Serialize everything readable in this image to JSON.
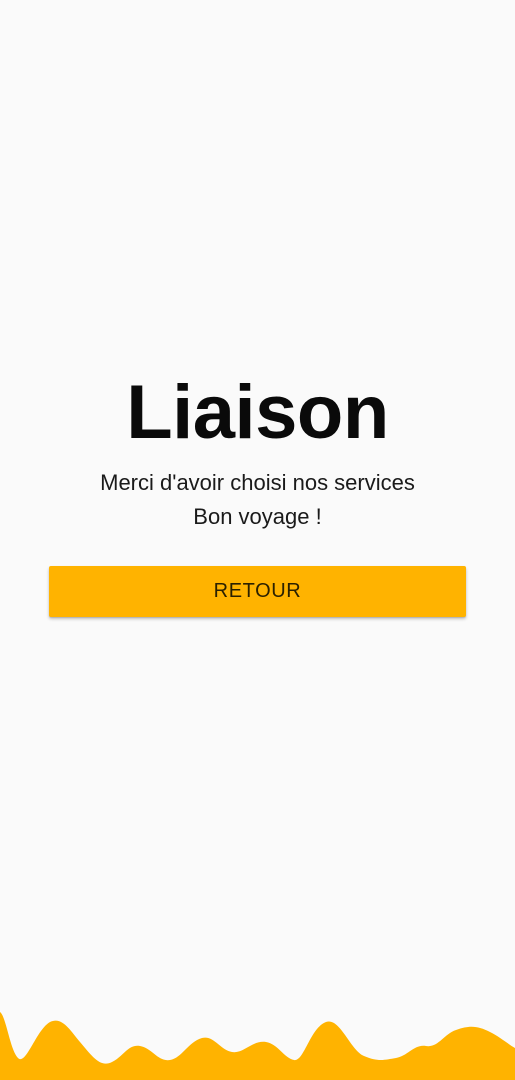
{
  "screen": {
    "title": "Liaison",
    "message_line_1": "Merci d'avoir choisi nos services",
    "message_line_2": "Bon voyage !",
    "retour_label": "RETOUR"
  },
  "colors": {
    "background": "#fafafa",
    "accent": "#ffb300",
    "title_text": "#0a0a0a"
  }
}
